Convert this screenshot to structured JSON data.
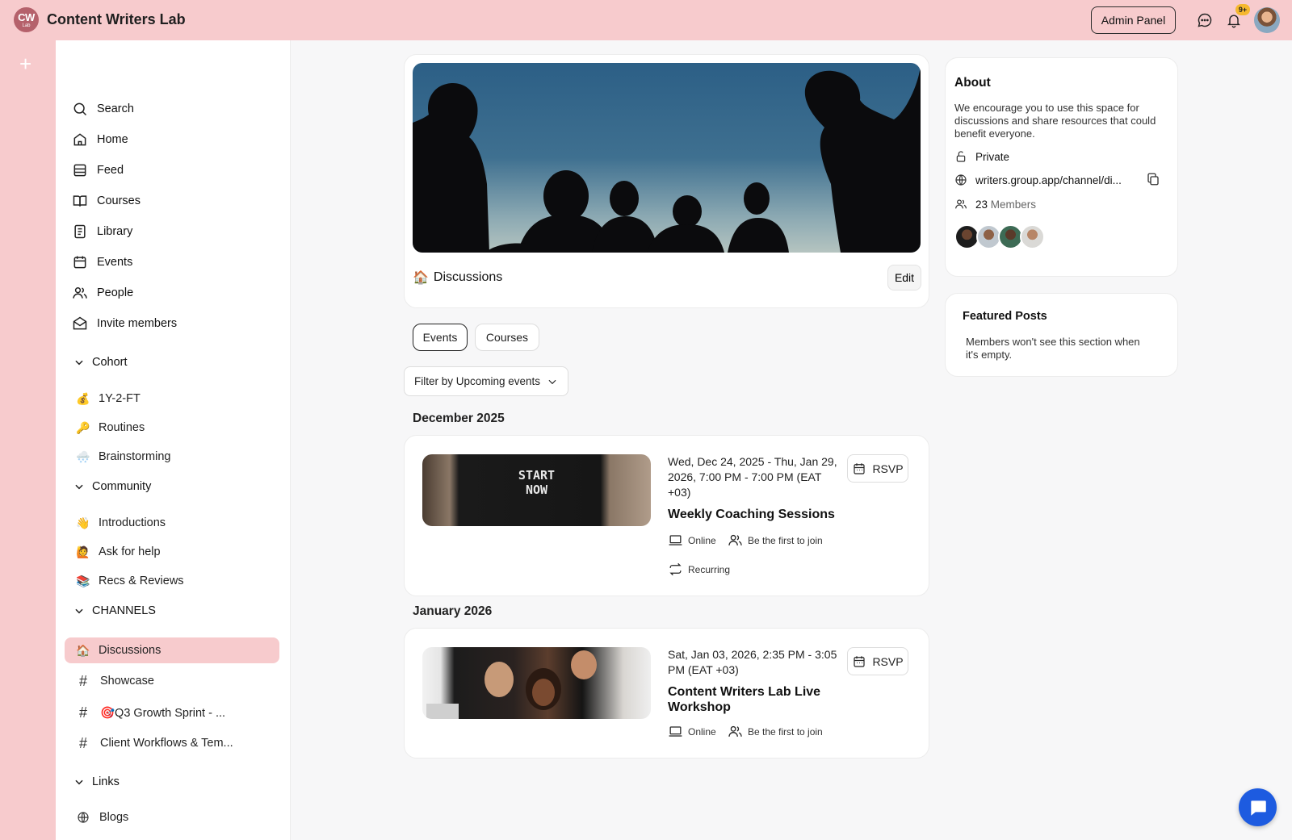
{
  "app": {
    "logo_text": "CW",
    "logo_subtext": "Lab",
    "title": "Content Writers Lab",
    "admin_label": "Admin Panel",
    "notification_count": "9+"
  },
  "sidebar": {
    "main_items": [
      {
        "label": "Search",
        "icon": "search-icon"
      },
      {
        "label": "Home",
        "icon": "home-icon"
      },
      {
        "label": "Feed",
        "icon": "feed-icon"
      },
      {
        "label": "Courses",
        "icon": "book-icon"
      },
      {
        "label": "Library",
        "icon": "document-icon"
      },
      {
        "label": "Events",
        "icon": "calendar-icon"
      },
      {
        "label": "People",
        "icon": "people-icon"
      },
      {
        "label": "Invite members",
        "icon": "envelope-icon"
      }
    ],
    "sections": [
      {
        "title": "Cohort",
        "items": [
          {
            "emoji": "💰",
            "label": "1Y-2-FT"
          },
          {
            "emoji": "🔑",
            "label": "Routines"
          },
          {
            "emoji": "🌨️",
            "label": "Brainstorming"
          }
        ]
      },
      {
        "title": "Community",
        "items": [
          {
            "emoji": "👋",
            "label": "Introductions"
          },
          {
            "emoji": "🙋",
            "label": "Ask for help"
          },
          {
            "emoji": "📚",
            "label": "Recs & Reviews"
          }
        ]
      },
      {
        "title": "CHANNELS",
        "items": [
          {
            "emoji": "🏠",
            "label": "Discussions",
            "active": true
          },
          {
            "hash": "#",
            "label": "Showcase"
          },
          {
            "hash": "#",
            "label": "🎯Q3 Growth Sprint - ..."
          },
          {
            "hash": "#",
            "label": "Client Workflows & Tem..."
          }
        ]
      },
      {
        "title": "Links",
        "items": [
          {
            "label": "Blogs",
            "icon": "globe-icon"
          }
        ]
      }
    ]
  },
  "channel": {
    "emoji": "🏠",
    "title": "Discussions",
    "edit_label": "Edit"
  },
  "tabs": [
    "Events",
    "Courses"
  ],
  "filter_label": "Filter by Upcoming events",
  "events": [
    {
      "month": "December 2025",
      "date": "Wed, Dec 24, 2025 - Thu, Jan 29, 2026, 7:00 PM - 7:00 PM (EAT +03)",
      "title": "Weekly Coaching Sessions",
      "location": "Online",
      "attendees": "Be the first to join",
      "recurring": "Recurring",
      "rsvp": "RSVP",
      "thumb_text_1": "START",
      "thumb_text_2": "NOW"
    },
    {
      "month": "January 2026",
      "date": "Sat, Jan 03, 2026, 2:35 PM - 3:05 PM (EAT +03)",
      "title": "Content Writers Lab Live Workshop",
      "location": "Online",
      "attendees": "Be the first to join",
      "rsvp": "RSVP"
    }
  ],
  "about": {
    "title": "About",
    "description": "We encourage you to use this space for discussions and share resources that could benefit everyone.",
    "privacy": "Private",
    "link": "writers.group.app/channel/di...",
    "member_count": "23",
    "member_label": "Members"
  },
  "featured": {
    "title": "Featured Posts",
    "description": "Members won't see this section when it's empty."
  },
  "colors": {
    "brand_pink": "#f7cbcd",
    "accent_blue": "#1d5be0",
    "badge_yellow": "#f5b82e"
  }
}
